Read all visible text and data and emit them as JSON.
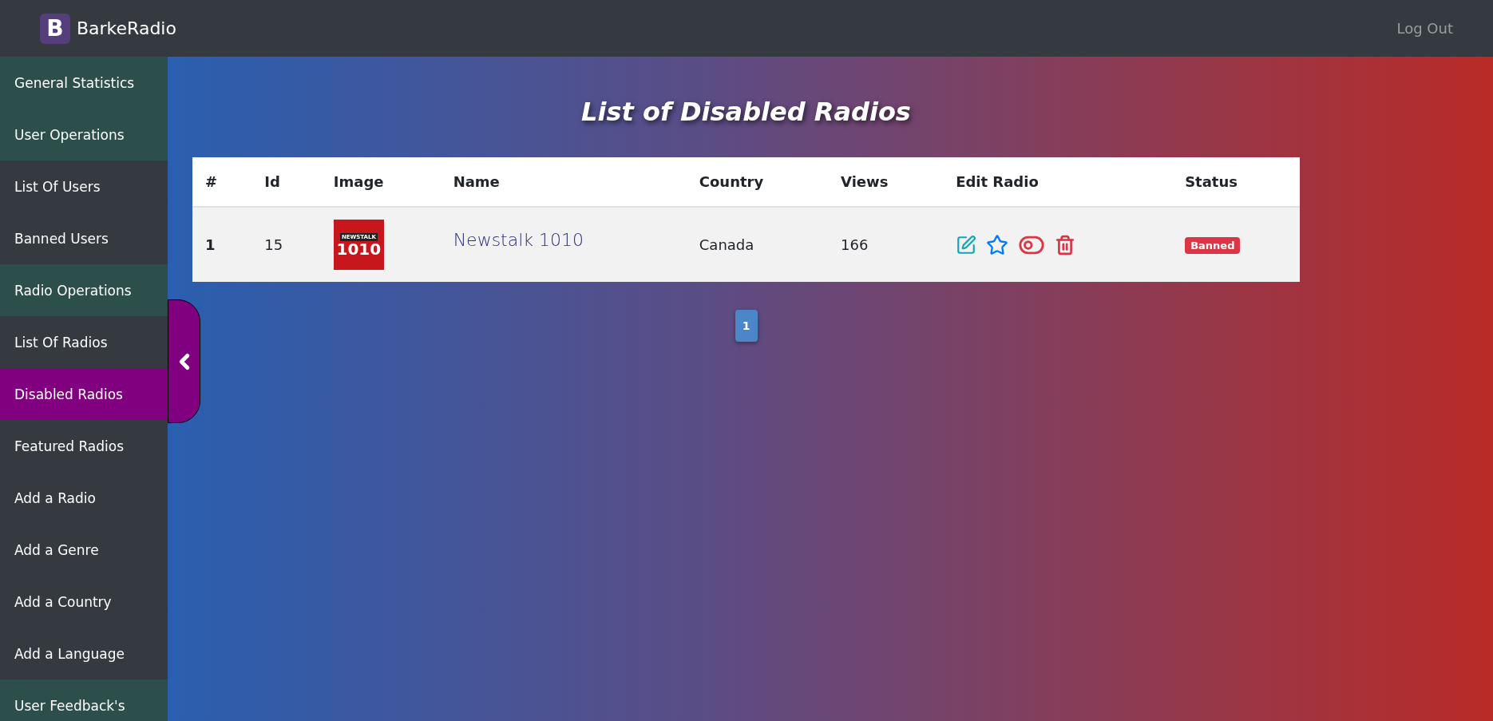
{
  "navbar": {
    "brand_letter": "B",
    "brand": "BarkeRadio",
    "logout": "Log Out"
  },
  "sidebar": {
    "items": [
      {
        "label": "General Statistics",
        "kind": "section",
        "selected": false
      },
      {
        "label": "User Operations",
        "kind": "section",
        "selected": false
      },
      {
        "label": "List Of Users",
        "kind": "link",
        "selected": false
      },
      {
        "label": "Banned Users",
        "kind": "link",
        "selected": false
      },
      {
        "label": "Radio Operations",
        "kind": "section",
        "selected": false
      },
      {
        "label": "List Of Radios",
        "kind": "link",
        "selected": false
      },
      {
        "label": "Disabled Radios",
        "kind": "link",
        "selected": true
      },
      {
        "label": "Featured Radios",
        "kind": "link",
        "selected": false
      },
      {
        "label": "Add a Radio",
        "kind": "link",
        "selected": false
      },
      {
        "label": "Add a Genre",
        "kind": "link",
        "selected": false
      },
      {
        "label": "Add a Country",
        "kind": "link",
        "selected": false
      },
      {
        "label": "Add a Language",
        "kind": "link",
        "selected": false
      },
      {
        "label": "User Feedback's",
        "kind": "section",
        "selected": false
      }
    ],
    "collapsed": false
  },
  "page_title": "List of Disabled Radios",
  "table": {
    "columns": [
      "#",
      "Id",
      "Image",
      "Name",
      "Country",
      "Views",
      "Edit Radio",
      "Status"
    ],
    "rows": [
      {
        "index": "1",
        "id": "15",
        "logo": {
          "line_1": "NEWSTALK",
          "line_2": "1010"
        },
        "name": "Newstalk 1010",
        "country": "Canada",
        "views": "166",
        "featured": false,
        "enabled": false,
        "status": "Banned"
      }
    ]
  },
  "pagination": [
    {
      "label": "1",
      "selected": true
    }
  ]
}
